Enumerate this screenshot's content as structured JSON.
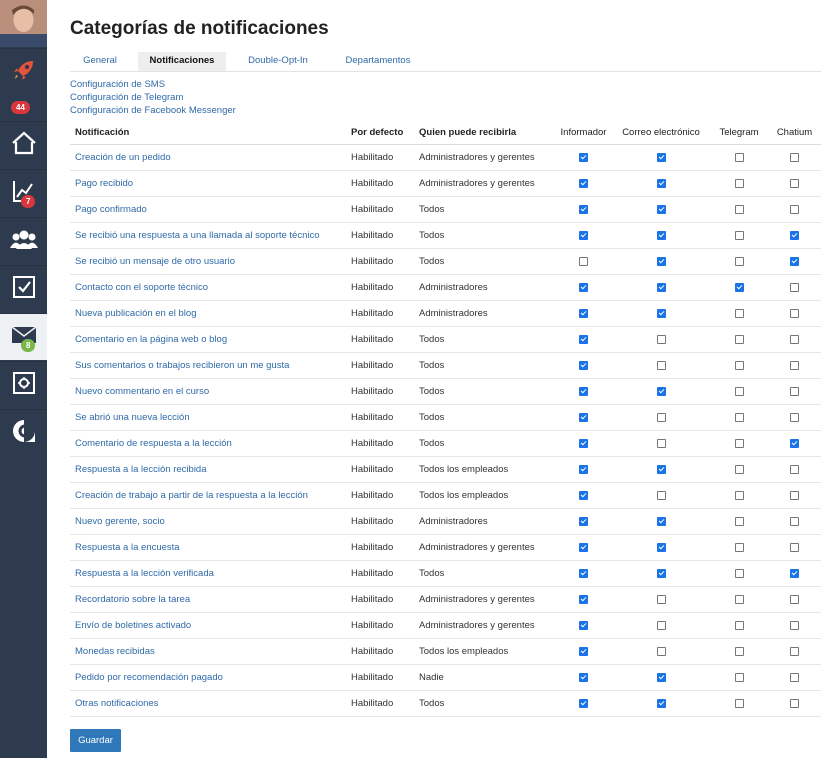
{
  "sidebar": {
    "badges": {
      "rocket": "44",
      "stats": "7",
      "mail": "8"
    }
  },
  "page": {
    "title": "Categorías de notificaciones"
  },
  "tabs": [
    "General",
    "Notificaciones",
    "Double-Opt-In",
    "Departamentos"
  ],
  "config_links": [
    "Configuración de SMS",
    "Configuración de Telegram",
    "Configuración de Facebook Messenger"
  ],
  "table": {
    "headers": [
      "Notificación",
      "Por defecto",
      "Quien puede recibirla",
      "Informador",
      "Correo electrónico",
      "Telegram",
      "Chatium"
    ],
    "rows": [
      {
        "name": "Creación de un pedido",
        "default": "Habilitado",
        "who": "Administradores y gerentes",
        "checks": [
          true,
          true,
          false,
          false
        ]
      },
      {
        "name": "Pago recibido",
        "default": "Habilitado",
        "who": "Administradores y gerentes",
        "checks": [
          true,
          true,
          false,
          false
        ]
      },
      {
        "name": "Pago confirmado",
        "default": "Habilitado",
        "who": "Todos",
        "checks": [
          true,
          true,
          false,
          false
        ]
      },
      {
        "name": "Se recibió una respuesta a una llamada al soporte técnico",
        "default": "Habilitado",
        "who": "Todos",
        "checks": [
          true,
          true,
          false,
          true
        ]
      },
      {
        "name": "Se recibió un mensaje de otro usuario",
        "default": "Habilitado",
        "who": "Todos",
        "checks": [
          false,
          true,
          false,
          true
        ]
      },
      {
        "name": "Contacto con el soporte técnico",
        "default": "Habilitado",
        "who": "Administradores",
        "checks": [
          true,
          true,
          true,
          false
        ]
      },
      {
        "name": "Nueva publicación en el blog",
        "default": "Habilitado",
        "who": "Administradores",
        "checks": [
          true,
          true,
          false,
          false
        ]
      },
      {
        "name": "Comentario en la página web o blog",
        "default": "Habilitado",
        "who": "Todos",
        "checks": [
          true,
          false,
          false,
          false
        ]
      },
      {
        "name": "Sus comentarios o trabajos recibieron un me gusta",
        "default": "Habilitado",
        "who": "Todos",
        "checks": [
          true,
          false,
          false,
          false
        ]
      },
      {
        "name": "Nuevo commentario en el curso",
        "default": "Habilitado",
        "who": "Todos",
        "checks": [
          true,
          true,
          false,
          false
        ]
      },
      {
        "name": "Se abrió una nueva lección",
        "default": "Habilitado",
        "who": "Todos",
        "checks": [
          true,
          false,
          false,
          false
        ]
      },
      {
        "name": "Comentario de respuesta a la lección",
        "default": "Habilitado",
        "who": "Todos",
        "checks": [
          true,
          false,
          false,
          true
        ]
      },
      {
        "name": "Respuesta a la lección recibida",
        "default": "Habilitado",
        "who": "Todos los empleados",
        "checks": [
          true,
          true,
          false,
          false
        ]
      },
      {
        "name": "Creación de trabajo a partir de la respuesta a la lección",
        "default": "Habilitado",
        "who": "Todos los empleados",
        "checks": [
          true,
          false,
          false,
          false
        ]
      },
      {
        "name": "Nuevo gerente, socio",
        "default": "Habilitado",
        "who": "Administradores",
        "checks": [
          true,
          true,
          false,
          false
        ]
      },
      {
        "name": "Respuesta a la encuesta",
        "default": "Habilitado",
        "who": "Administradores y gerentes",
        "checks": [
          true,
          true,
          false,
          false
        ]
      },
      {
        "name": "Respuesta a la lección verificada",
        "default": "Habilitado",
        "who": "Todos",
        "checks": [
          true,
          true,
          false,
          true
        ]
      },
      {
        "name": "Recordatorio sobre la tarea",
        "default": "Habilitado",
        "who": "Administradores y gerentes",
        "checks": [
          true,
          false,
          false,
          false
        ]
      },
      {
        "name": "Envío de boletines activado",
        "default": "Habilitado",
        "who": "Administradores y gerentes",
        "checks": [
          true,
          false,
          false,
          false
        ]
      },
      {
        "name": "Monedas recibidas",
        "default": "Habilitado",
        "who": "Todos los empleados",
        "checks": [
          true,
          false,
          false,
          false
        ]
      },
      {
        "name": "Pedido por recomendación pagado",
        "default": "Habilitado",
        "who": "Nadie",
        "checks": [
          true,
          true,
          false,
          false
        ]
      },
      {
        "name": "Otras notificaciones",
        "default": "Habilitado",
        "who": "Todos",
        "checks": [
          true,
          true,
          false,
          false
        ]
      }
    ]
  },
  "save_label": "Guardar",
  "colors": {
    "sidebar": "#2e3b4e",
    "link": "#2f6aa8",
    "button": "#2f79ba",
    "checkbox": "#1a73e8"
  }
}
